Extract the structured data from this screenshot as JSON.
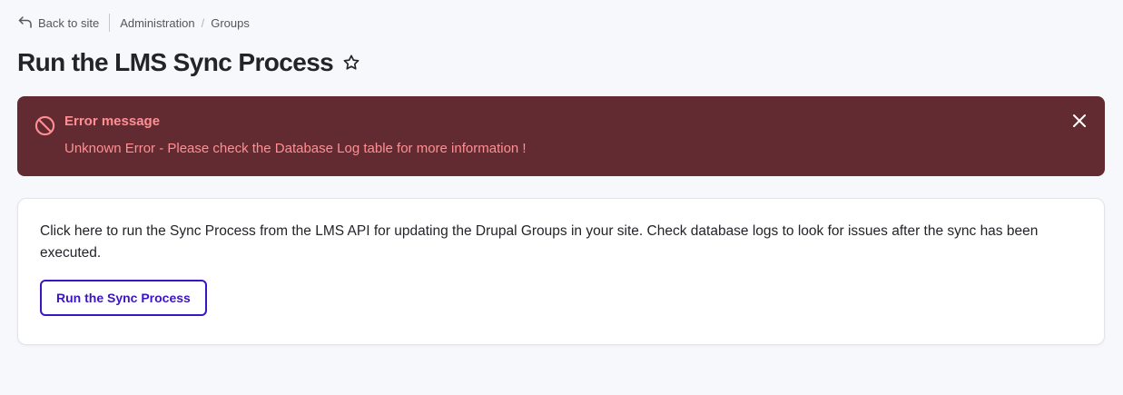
{
  "topbar": {
    "back_label": "Back to site",
    "back_icon": "arrow-return-left-icon",
    "breadcrumb": [
      {
        "label": "Administration"
      },
      {
        "label": "Groups"
      }
    ],
    "breadcrumb_separator": "/"
  },
  "page": {
    "title": "Run the LMS Sync Process",
    "star_icon": "star-outline-icon"
  },
  "error": {
    "title": "Error message",
    "text": "Unknown Error - Please check the Database Log table for more information !",
    "icon": "prohibited-icon",
    "close_icon": "close-icon",
    "background_color": "#622b31",
    "text_color": "#ff8f94"
  },
  "content": {
    "description": "Click here to run the Sync Process from the LMS API for updating the Drupal Groups in your site. Check database logs to look for issues after the sync has been executed.",
    "button_label": "Run the Sync Process",
    "accent_color": "#3b14c4"
  }
}
